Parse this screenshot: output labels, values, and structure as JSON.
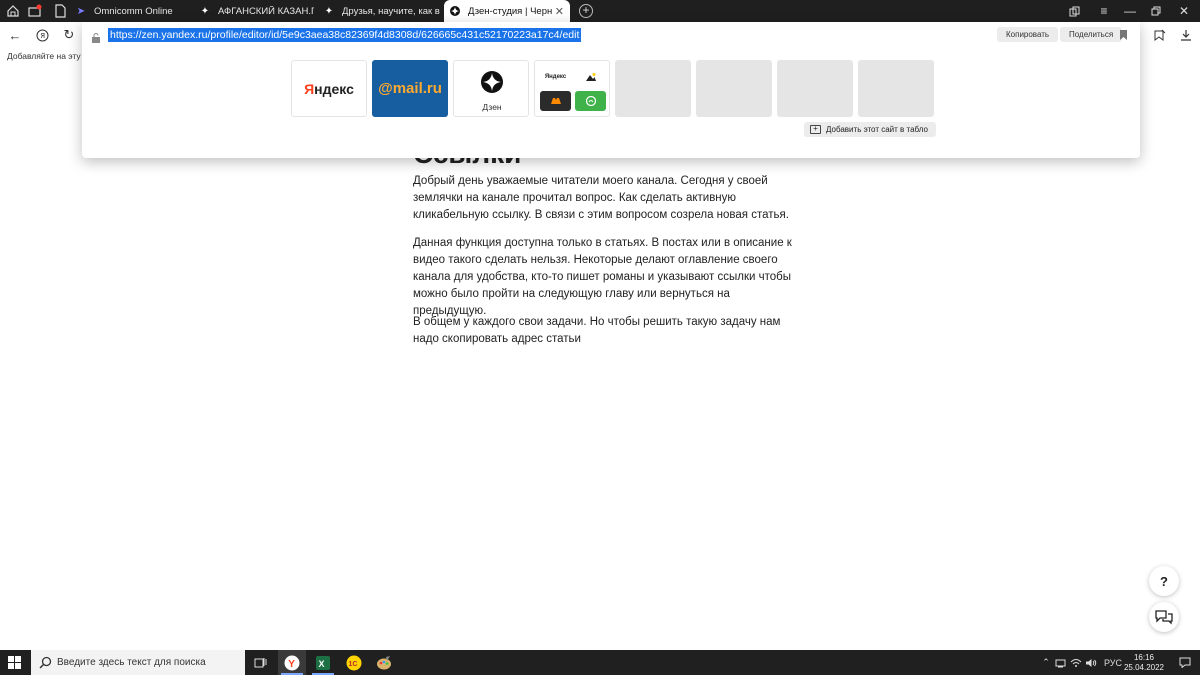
{
  "tabs": [
    {
      "label": "Omnicomm Online",
      "active": false
    },
    {
      "label": "АФГАНСКИЙ КАЗАН.ПОД",
      "active": false
    },
    {
      "label": "Друзья, научите, как в но",
      "active": false
    },
    {
      "label": "Дзен-студия | Черновик",
      "active": true
    }
  ],
  "address_bar": {
    "url": "https://zen.yandex.ru/profile/editor/id/5e9c3aea38c82369f4d8308d/626665c431c52170223a17c4/edit",
    "copy_label": "Копировать",
    "share_label": "Поделиться"
  },
  "bookmarks_bar": {
    "text": "Добавляйте на эту пан"
  },
  "speed_dial": {
    "tiles": [
      {
        "label": "Яндекс"
      },
      {
        "label": "@mail.ru"
      },
      {
        "label": "Дзен"
      },
      {
        "mini_label": "Яндекс"
      }
    ],
    "add_site_label": "Добавить этот сайт в табло"
  },
  "article": {
    "heading": "Ссылки",
    "paragraphs": [
      "Добрый день уважаемые читатели моего канала. Сегодня у своей землячки на канале прочитал вопрос. Как сделать активную кликабельную ссылку. В связи с этим вопросом созрела новая статья.",
      "Данная функция доступна только в статьях. В постах или в описание к видео такого сделать нельзя. Некоторые делают оглавление своего канала для удобства, кто-то пишет романы и указывают ссылки чтобы можно было пройти на следующую главу или вернуться на предыдущую.",
      "В общем у каждого свои задачи. Но чтобы решить такую задачу нам надо скопировать адрес статьи"
    ]
  },
  "help_button": {
    "label": "?"
  },
  "taskbar": {
    "search_placeholder": "Введите здесь текст для поиска",
    "language": "РУС",
    "time": "16:16",
    "date": "25.04.2022"
  },
  "colors": {
    "accent": "#1a73e8",
    "yandex_red": "#fc3f1d",
    "mail_blue": "#165ea0",
    "mail_orange": "#ffa930"
  }
}
